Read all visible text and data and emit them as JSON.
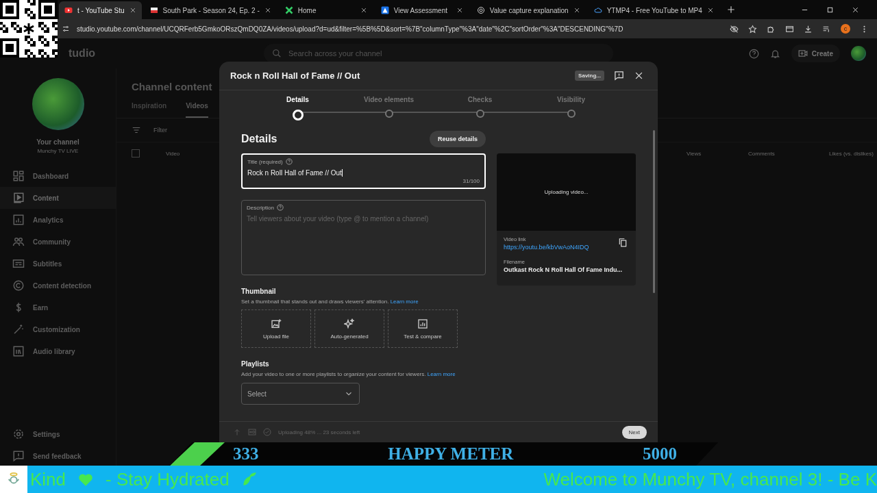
{
  "browser": {
    "tabs": [
      {
        "title": "t - YouTube Stu",
        "selected": true
      },
      {
        "title": "South Park - Season 24, Ep. 2 -",
        "selected": false
      },
      {
        "title": "Home",
        "selected": false
      },
      {
        "title": "View Assessment",
        "selected": false
      },
      {
        "title": "Value capture explanation",
        "selected": false
      },
      {
        "title": "YTMP4 - Free YouTube to MP4",
        "selected": false
      }
    ],
    "address": "studio.youtube.com/channel/UCQRFerb5GmkoORszQmDQ0ZA/videos/upload?d=ud&filter=%5B%5D&sort=%7B\"columnType\"%3A\"date\"%2C\"sortOrder\"%3A\"DESCENDING\"%7D",
    "profile_initial": "c"
  },
  "studio": {
    "logo": "tudio",
    "search_placeholder": "Search across your channel",
    "create_button": "Create"
  },
  "sidebar": {
    "channel_title": "Your channel",
    "channel_name": "Munchy TV LIVE",
    "items": [
      {
        "label": "Dashboard",
        "selected": false
      },
      {
        "label": "Content",
        "selected": true
      },
      {
        "label": "Analytics",
        "selected": false
      },
      {
        "label": "Community",
        "selected": false
      },
      {
        "label": "Subtitles",
        "selected": false
      },
      {
        "label": "Content detection",
        "selected": false
      },
      {
        "label": "Earn",
        "selected": false
      },
      {
        "label": "Customization",
        "selected": false
      },
      {
        "label": "Audio library",
        "selected": false
      }
    ],
    "footer_items": [
      "Settings",
      "Send feedback"
    ]
  },
  "channel_content": {
    "title": "Channel content",
    "tabs": [
      {
        "label": "Inspiration",
        "selected": false
      },
      {
        "label": "Videos",
        "selected": true
      }
    ],
    "filter_placeholder": "Filter",
    "select_all_checked": false,
    "columns": [
      "Video",
      "Views",
      "Comments",
      "Likes (vs. dislikes)"
    ]
  },
  "dialog": {
    "title": "Rock n Roll Hall of Fame // Out",
    "badge": "Saving...",
    "steps": [
      {
        "label": "Details",
        "selected": true
      },
      {
        "label": "Video elements",
        "selected": false
      },
      {
        "label": "Checks",
        "selected": false
      },
      {
        "label": "Visibility",
        "selected": false
      }
    ],
    "heading": "Details",
    "reuse_button": "Reuse details",
    "title_field": {
      "label": "Title (required)",
      "value": "Rock n Roll Hall of Fame // Out",
      "counter": "31/100"
    },
    "description_field": {
      "label": "Description",
      "placeholder": "Tell viewers about your video (type @ to mention a channel)"
    },
    "preview": {
      "status": "Uploading video...",
      "link_label": "Video link",
      "link": "https://youtu.be/kbVwAoN4IDQ",
      "filename_label": "Filename",
      "filename": "Outkast Rock N Roll Hall Of Fame Indu..."
    },
    "thumbnail": {
      "heading": "Thumbnail",
      "text": "Set a thumbnail that stands out and draws viewers' attention.",
      "link": "Learn more",
      "options": [
        "Upload file",
        "Auto-generated",
        "Test & compare"
      ]
    },
    "playlists": {
      "heading": "Playlists",
      "text": "Add your video to one or more playlists to organize your content for viewers.",
      "link": "Learn more",
      "select": "Select"
    },
    "footer": {
      "status": "Uploading 48% ... 23 seconds left",
      "next": "Next"
    }
  },
  "happy_meter": {
    "level": 0.1,
    "current": "333",
    "title": "HAPPY METER",
    "goal": "5000"
  },
  "ticker": {
    "texts": [
      "Kind",
      "- Stay Hydrated",
      "Welcome to Munchy TV, channel 3!  - Be K"
    ]
  }
}
